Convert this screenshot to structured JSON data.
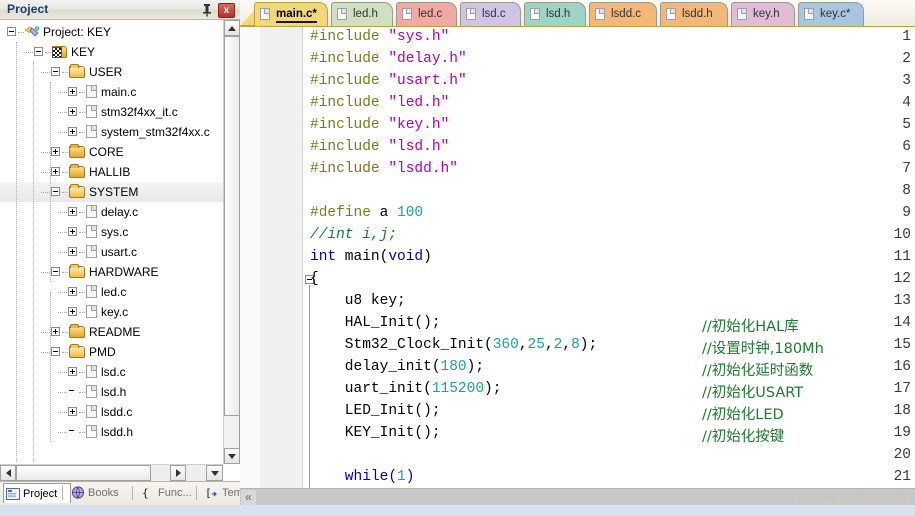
{
  "project_pane": {
    "title": "Project",
    "pin_icon": "pin-icon",
    "close_label": "x",
    "tree": [
      {
        "label": "Project: KEY",
        "depth": 0,
        "toggle": "minus",
        "icon": "project-icon",
        "selected": false
      },
      {
        "label": "KEY",
        "depth": 1,
        "toggle": "minus",
        "icon": "target-icon",
        "selected": false
      },
      {
        "label": "USER",
        "depth": 2,
        "toggle": "minus",
        "icon": "folder-open-icon",
        "selected": false
      },
      {
        "label": "main.c",
        "depth": 3,
        "toggle": "plus",
        "icon": "file-icon",
        "selected": false
      },
      {
        "label": "stm32f4xx_it.c",
        "depth": 3,
        "toggle": "plus",
        "icon": "file-icon",
        "selected": false
      },
      {
        "label": "system_stm32f4xx.c",
        "depth": 3,
        "toggle": "plus",
        "icon": "file-icon",
        "selected": false
      },
      {
        "label": "CORE",
        "depth": 2,
        "toggle": "plus",
        "icon": "folder-icon",
        "selected": false
      },
      {
        "label": "HALLIB",
        "depth": 2,
        "toggle": "plus",
        "icon": "folder-icon",
        "selected": false
      },
      {
        "label": "SYSTEM",
        "depth": 2,
        "toggle": "minus",
        "icon": "folder-open-icon",
        "selected": true
      },
      {
        "label": "delay.c",
        "depth": 3,
        "toggle": "plus",
        "icon": "file-icon",
        "selected": false
      },
      {
        "label": "sys.c",
        "depth": 3,
        "toggle": "plus",
        "icon": "file-icon",
        "selected": false
      },
      {
        "label": "usart.c",
        "depth": 3,
        "toggle": "plus",
        "icon": "file-icon",
        "selected": false
      },
      {
        "label": "HARDWARE",
        "depth": 2,
        "toggle": "minus",
        "icon": "folder-open-icon",
        "selected": false
      },
      {
        "label": "led.c",
        "depth": 3,
        "toggle": "plus",
        "icon": "file-icon",
        "selected": false
      },
      {
        "label": "key.c",
        "depth": 3,
        "toggle": "plus",
        "icon": "file-icon",
        "selected": false
      },
      {
        "label": "README",
        "depth": 2,
        "toggle": "plus",
        "icon": "folder-icon",
        "selected": false
      },
      {
        "label": "PMD",
        "depth": 2,
        "toggle": "minus",
        "icon": "folder-open-icon",
        "selected": false
      },
      {
        "label": "lsd.c",
        "depth": 3,
        "toggle": "plus",
        "icon": "file-icon",
        "selected": false
      },
      {
        "label": "lsd.h",
        "depth": 3,
        "toggle": "none",
        "icon": "file-icon",
        "selected": false
      },
      {
        "label": "lsdd.c",
        "depth": 3,
        "toggle": "plus",
        "icon": "file-icon",
        "selected": false
      },
      {
        "label": "lsdd.h",
        "depth": 3,
        "toggle": "none",
        "icon": "file-icon",
        "selected": false
      }
    ],
    "bottom_tabs": [
      {
        "label": "Project",
        "icon": "project-tab-icon",
        "active": true
      },
      {
        "label": "Books",
        "icon": "books-icon",
        "active": false
      },
      {
        "label": "Func...",
        "icon": "braces-icon",
        "active": false
      },
      {
        "label": "Tem...",
        "icon": "template-icon",
        "active": false
      }
    ]
  },
  "editor": {
    "tabs": [
      {
        "label": "main.c*",
        "color": "#f4d77b",
        "active": true,
        "modified": true
      },
      {
        "label": "led.h",
        "color": "#cfdfc0",
        "active": false,
        "modified": false
      },
      {
        "label": "led.c",
        "color": "#f0a9a4",
        "active": false,
        "modified": false
      },
      {
        "label": "lsd.c",
        "color": "#cfc3e6",
        "active": false,
        "modified": false
      },
      {
        "label": "lsd.h",
        "color": "#9ed4c6",
        "active": false,
        "modified": false
      },
      {
        "label": "lsdd.c",
        "color": "#f5b777",
        "active": false,
        "modified": false
      },
      {
        "label": "lsdd.h",
        "color": "#f5b777",
        "active": false,
        "modified": false
      },
      {
        "label": "key.h",
        "color": "#e2bcd6",
        "active": false,
        "modified": false
      },
      {
        "label": "key.c*",
        "color": "#a8c6e0",
        "active": false,
        "modified": true
      }
    ],
    "lines": [
      {
        "n": 1,
        "tokens": [
          {
            "t": "#include ",
            "c": "pre"
          },
          {
            "t": "\"sys.h\"",
            "c": "str"
          }
        ]
      },
      {
        "n": 2,
        "tokens": [
          {
            "t": "#include ",
            "c": "pre"
          },
          {
            "t": "\"delay.h\"",
            "c": "str"
          }
        ]
      },
      {
        "n": 3,
        "tokens": [
          {
            "t": "#include ",
            "c": "pre"
          },
          {
            "t": "\"usart.h\"",
            "c": "str"
          }
        ]
      },
      {
        "n": 4,
        "tokens": [
          {
            "t": "#include ",
            "c": "pre"
          },
          {
            "t": "\"led.h\"",
            "c": "str"
          }
        ]
      },
      {
        "n": 5,
        "tokens": [
          {
            "t": "#include ",
            "c": "pre"
          },
          {
            "t": "\"key.h\"",
            "c": "str"
          }
        ]
      },
      {
        "n": 6,
        "tokens": [
          {
            "t": "#include ",
            "c": "pre"
          },
          {
            "t": "\"lsd.h\"",
            "c": "str"
          }
        ]
      },
      {
        "n": 7,
        "tokens": [
          {
            "t": "#include ",
            "c": "pre"
          },
          {
            "t": "\"lsdd.h\"",
            "c": "str"
          }
        ]
      },
      {
        "n": 8,
        "tokens": []
      },
      {
        "n": 9,
        "tokens": [
          {
            "t": "#define ",
            "c": "pre"
          },
          {
            "t": "a ",
            "c": "pln"
          },
          {
            "t": "100",
            "c": "num"
          }
        ]
      },
      {
        "n": 10,
        "tokens": [
          {
            "t": "//int i,j;",
            "c": "cmt"
          }
        ]
      },
      {
        "n": 11,
        "tokens": [
          {
            "t": "int",
            "c": "kw"
          },
          {
            "t": " main(",
            "c": "pln"
          },
          {
            "t": "void",
            "c": "kw"
          },
          {
            "t": ")",
            "c": "pln"
          }
        ]
      },
      {
        "n": 12,
        "tokens": [
          {
            "t": "{",
            "c": "pln"
          }
        ]
      },
      {
        "n": 13,
        "tokens": [
          {
            "t": "    u8 key;",
            "c": "pln"
          }
        ]
      },
      {
        "n": 14,
        "tokens": [
          {
            "t": "    HAL_Init();",
            "c": "pln"
          }
        ],
        "comment": "//初始化HAL库"
      },
      {
        "n": 15,
        "tokens": [
          {
            "t": "    Stm32_Clock_Init(",
            "c": "pln"
          },
          {
            "t": "360",
            "c": "num"
          },
          {
            "t": ",",
            "c": "pln"
          },
          {
            "t": "25",
            "c": "num"
          },
          {
            "t": ",",
            "c": "pln"
          },
          {
            "t": "2",
            "c": "num"
          },
          {
            "t": ",",
            "c": "pln"
          },
          {
            "t": "8",
            "c": "num"
          },
          {
            "t": ");",
            "c": "pln"
          }
        ],
        "comment": "//设置时钟,180Mh"
      },
      {
        "n": 16,
        "tokens": [
          {
            "t": "    delay_init(",
            "c": "pln"
          },
          {
            "t": "180",
            "c": "num"
          },
          {
            "t": ");",
            "c": "pln"
          }
        ],
        "comment": "//初始化延时函数"
      },
      {
        "n": 17,
        "tokens": [
          {
            "t": "    uart_init(",
            "c": "pln"
          },
          {
            "t": "115200",
            "c": "num"
          },
          {
            "t": ");",
            "c": "pln"
          }
        ],
        "comment": "//初始化USART"
      },
      {
        "n": 18,
        "tokens": [
          {
            "t": "    LED_Init();",
            "c": "pln"
          }
        ],
        "comment": "//初始化LED"
      },
      {
        "n": 19,
        "tokens": [
          {
            "t": "    KEY_Init();",
            "c": "pln"
          }
        ],
        "comment": "//初始化按键"
      },
      {
        "n": 20,
        "tokens": []
      },
      {
        "n": 21,
        "tokens": [
          {
            "t": "    while(",
            "c": "kw"
          },
          {
            "t": "1",
            "c": "num"
          },
          {
            "t": ")",
            "c": "kw"
          }
        ]
      }
    ],
    "hscroll_left_glyph": "«"
  },
  "watermark": "CSDN @文静之森",
  "colors": {
    "keyword": "#0000c0",
    "preproc": "#7d7a1e",
    "string": "#b300b3",
    "number": "#1f9fa8",
    "comment": "#1f7a2e",
    "active_tab": "#f4d77b"
  }
}
